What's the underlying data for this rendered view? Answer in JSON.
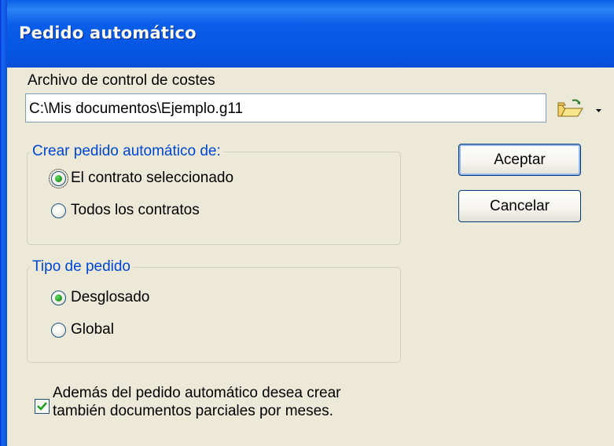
{
  "window": {
    "title": "Pedido automático"
  },
  "file": {
    "label": "Archivo de control de costes",
    "value": "C:\\Mis documentos\\Ejemplo.g11",
    "browse_icon": "open-folder-icon",
    "dropdown_icon": "dropdown-arrow-icon"
  },
  "group_scope": {
    "title": "Crear pedido automático de:",
    "options": [
      {
        "label": "El contrato seleccionado",
        "checked": true
      },
      {
        "label": "Todos los contratos",
        "checked": false
      }
    ]
  },
  "group_type": {
    "title": "Tipo de pedido",
    "options": [
      {
        "label": "Desglosado",
        "checked": true
      },
      {
        "label": "Global",
        "checked": false
      }
    ]
  },
  "buttons": {
    "ok": "Aceptar",
    "cancel": "Cancelar"
  },
  "checkbox": {
    "checked": true,
    "line1": "Además del pedido automático desea crear",
    "line2": "también documentos parciales por meses."
  },
  "colors": {
    "titlebar": "#0a5fe6",
    "dialog_bg": "#ece9d8",
    "group_title": "#0046d5",
    "radio_dot": "#21a121"
  }
}
